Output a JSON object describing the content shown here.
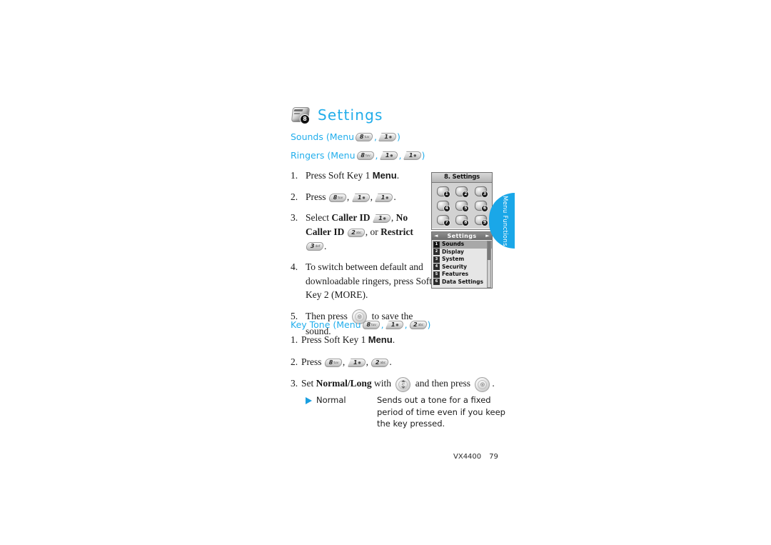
{
  "page": {
    "title": "Settings",
    "title_icon_badge": "8",
    "footer_model": "VX4400",
    "footer_page": "79",
    "side_tab_label": "Menu Functions",
    "heading_color": "#22aeec",
    "accent_color": "#1aa7e8"
  },
  "sections": {
    "sounds": {
      "label": "Sounds (Menu",
      "keys": [
        {
          "num": "8",
          "sub": "tuv",
          "shape": "rounded"
        },
        {
          "num": "1",
          "sub": "●",
          "shape": "flag"
        }
      ],
      "close": ")"
    },
    "ringers": {
      "label": "Ringers (Menu",
      "keys": [
        {
          "num": "8",
          "sub": "tuv",
          "shape": "rounded"
        },
        {
          "num": "1",
          "sub": "●",
          "shape": "flag"
        },
        {
          "num": "1",
          "sub": "●",
          "shape": "flag"
        }
      ],
      "close": ")"
    },
    "keytone": {
      "label": "Key Tone (Menu",
      "keys": [
        {
          "num": "8",
          "sub": "tuv",
          "shape": "rounded"
        },
        {
          "num": "1",
          "sub": "●",
          "shape": "flag"
        },
        {
          "num": "2",
          "sub": "abc",
          "shape": "rounded"
        }
      ],
      "close": ")"
    }
  },
  "steps_ringers": [
    {
      "num": "1.",
      "pre": "Press Soft Key 1 ",
      "bold": "Menu",
      "post": "."
    },
    {
      "num": "2.",
      "pre": "Press ",
      "keys": [
        {
          "num": "8",
          "sub": "tuv",
          "shape": "rounded"
        },
        {
          "num": "1",
          "sub": "●",
          "shape": "flag"
        },
        {
          "num": "1",
          "sub": "●",
          "shape": "flag"
        }
      ],
      "post": "."
    },
    {
      "num": "3.",
      "text": "Select Caller ID , No Caller ID , or Restrict .",
      "bold1": "Caller ID",
      "bold2": "No Caller",
      "bold3": "ID",
      "bold4": "Restrict",
      "lead": "Select ",
      "mid": ", ",
      "mid2": ", or ",
      "keys": [
        {
          "num": "1",
          "sub": "●",
          "shape": "flag"
        },
        {
          "num": "2",
          "sub": "abc",
          "shape": "rounded"
        },
        {
          "num": "3",
          "sub": "def",
          "shape": "rounded"
        }
      ]
    },
    {
      "num": "4.",
      "text": "To switch between default and downloadable ringers, press Soft Key 2 (MORE)."
    },
    {
      "num": "5.",
      "pre": "Then press ",
      "post": " to save the sound.",
      "okkey": "OK"
    }
  ],
  "steps_keytone": [
    {
      "num": "1.",
      "pre": "Press Soft Key 1 ",
      "bold": "Menu",
      "post": "."
    },
    {
      "num": "2.",
      "pre": "Press ",
      "keys": [
        {
          "num": "8",
          "sub": "tuv",
          "shape": "rounded"
        },
        {
          "num": "1",
          "sub": "●",
          "shape": "flag"
        },
        {
          "num": "2",
          "sub": "abc",
          "shape": "rounded"
        }
      ],
      "post": "."
    },
    {
      "num": "3.",
      "pre": "Set ",
      "bold": "Normal/Long",
      "mid": " with ",
      "mid2": " and then press ",
      "post": "."
    }
  ],
  "normal_option": {
    "label": "Normal",
    "description": "Sends out a tone for a fixed period of time even if you keep the key pressed."
  },
  "phone_grid_screen": {
    "header": "8. Settings",
    "icons": [
      {
        "badge": "1"
      },
      {
        "badge": "2"
      },
      {
        "badge": "3"
      },
      {
        "badge": "4"
      },
      {
        "badge": "5"
      },
      {
        "badge": "6"
      },
      {
        "badge": "7"
      },
      {
        "badge": "8"
      },
      {
        "badge": "9"
      }
    ]
  },
  "phone_list_screen": {
    "header": "Settings",
    "left_arrow": "◄",
    "right_arrow": "►",
    "items": [
      {
        "mark": "1",
        "label": "Sounds",
        "selected": true
      },
      {
        "mark": "2",
        "label": "Display",
        "selected": false
      },
      {
        "mark": "3",
        "label": "System",
        "selected": false
      },
      {
        "mark": "4",
        "label": "Security",
        "selected": false
      },
      {
        "mark": "5",
        "label": "Features",
        "selected": false
      },
      {
        "mark": "6",
        "label": "Data Settings",
        "selected": false
      }
    ]
  }
}
